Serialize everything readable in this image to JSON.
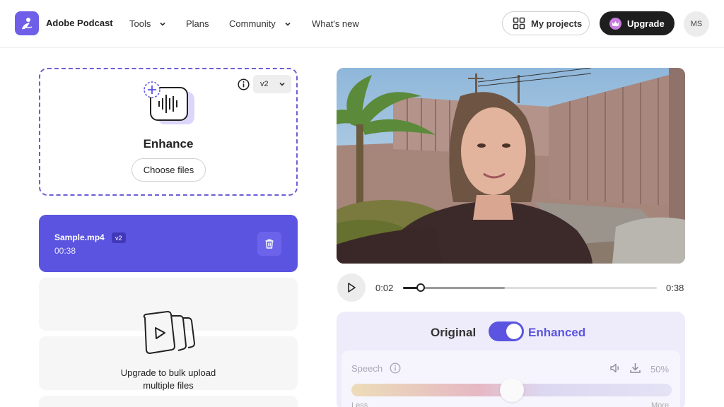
{
  "header": {
    "app_name": "Adobe Podcast",
    "nav": [
      {
        "label": "Tools",
        "has_dropdown": true
      },
      {
        "label": "Plans",
        "has_dropdown": false
      },
      {
        "label": "Community",
        "has_dropdown": true
      },
      {
        "label": "What's new",
        "has_dropdown": false
      }
    ],
    "my_projects_label": "My projects",
    "upgrade_label": "Upgrade",
    "avatar_initials": "MS"
  },
  "enhance_dropzone": {
    "title": "Enhance",
    "choose_files_label": "Choose files",
    "version": "v2"
  },
  "file": {
    "name": "Sample.mp4",
    "version_badge": "v2",
    "duration": "00:38"
  },
  "bulk_upload": {
    "line1": "Upgrade to bulk upload",
    "line2": "multiple files"
  },
  "player": {
    "current_time": "0:02",
    "total_time": "0:38",
    "progress_fraction": 0.07,
    "buffered_fraction": 0.4
  },
  "enhance_panel": {
    "original_label": "Original",
    "enhanced_label": "Enhanced",
    "enhanced_on": true,
    "speech_label": "Speech",
    "speech_value": "50%",
    "speech_fraction": 0.5,
    "less_label": "Less",
    "more_label": "More"
  },
  "colors": {
    "accent": "#5b54e0",
    "brand": "#6f5fe8",
    "dark_button": "#1e1e1e"
  }
}
